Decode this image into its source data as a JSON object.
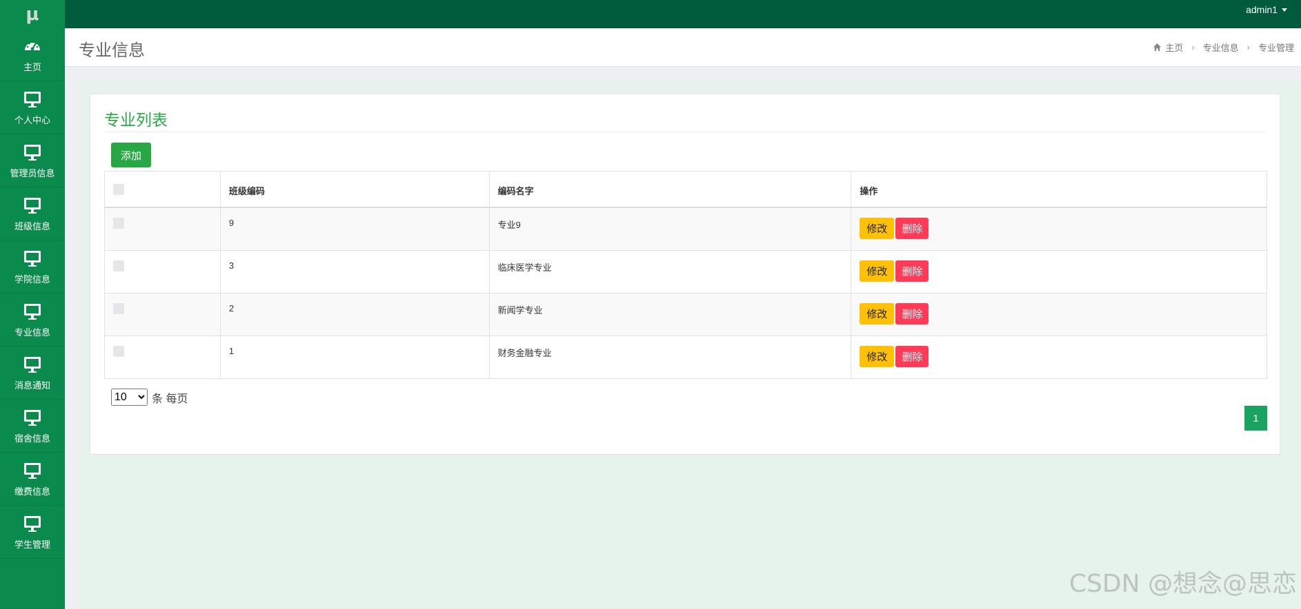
{
  "brand": {
    "logo_text": "μ"
  },
  "topbar": {
    "user_name": "admin1"
  },
  "sidebar": {
    "items": [
      {
        "label": "主页",
        "icon": "dashboard-icon"
      },
      {
        "label": "个人中心",
        "icon": "monitor-icon"
      },
      {
        "label": "管理员信息",
        "icon": "monitor-icon"
      },
      {
        "label": "班级信息",
        "icon": "monitor-icon"
      },
      {
        "label": "学院信息",
        "icon": "monitor-icon"
      },
      {
        "label": "专业信息",
        "icon": "monitor-icon"
      },
      {
        "label": "消息通知",
        "icon": "monitor-icon"
      },
      {
        "label": "宿舍信息",
        "icon": "monitor-icon"
      },
      {
        "label": "缴费信息",
        "icon": "monitor-icon"
      },
      {
        "label": "学生管理",
        "icon": "monitor-icon"
      }
    ]
  },
  "header": {
    "title": "专业信息",
    "breadcrumb": [
      "主页",
      "专业信息",
      "专业管理"
    ]
  },
  "panel": {
    "title": "专业列表",
    "add_label": "添加",
    "columns": [
      "",
      "班级编码",
      "编码名字",
      "操作"
    ],
    "rows": [
      {
        "code": "9",
        "name": "专业9"
      },
      {
        "code": "3",
        "name": "临床医学专业"
      },
      {
        "code": "2",
        "name": "新闻学专业"
      },
      {
        "code": "1",
        "name": "财务金融专业"
      }
    ],
    "edit_label": "修改",
    "delete_label": "删除",
    "per_page_value": "10",
    "per_page_suffix": "条 每页",
    "current_page": "1"
  },
  "colors": {
    "topbar": "#005a3c",
    "sidebar": "#0a8a4c",
    "accent": "#28a745",
    "edit": "#ffc107",
    "delete": "#ff3b57",
    "content_bg": "#e6f3ec"
  },
  "watermark": "CSDN @想念@思恋"
}
